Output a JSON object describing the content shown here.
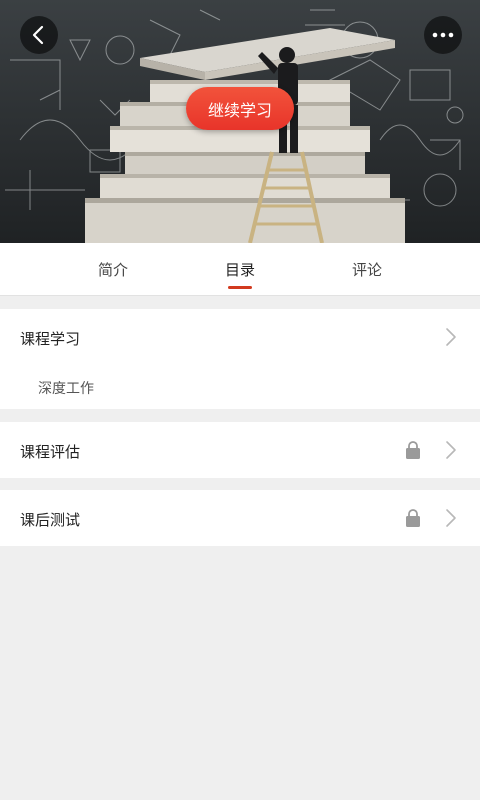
{
  "hero": {
    "continue_label": "继续学习",
    "back_icon": "chevron-left-icon",
    "more_icon": "more-dots-icon"
  },
  "tabs": [
    {
      "label": "简介",
      "active": false
    },
    {
      "label": "目录",
      "active": true
    },
    {
      "label": "评论",
      "active": false
    }
  ],
  "accent_color": "#d23a1f",
  "catalog": {
    "course_study": {
      "title": "课程学习",
      "items": [
        "深度工作"
      ]
    },
    "course_eval": {
      "title": "课程评估",
      "locked": true
    },
    "post_test": {
      "title": "课后测试",
      "locked": true
    }
  }
}
